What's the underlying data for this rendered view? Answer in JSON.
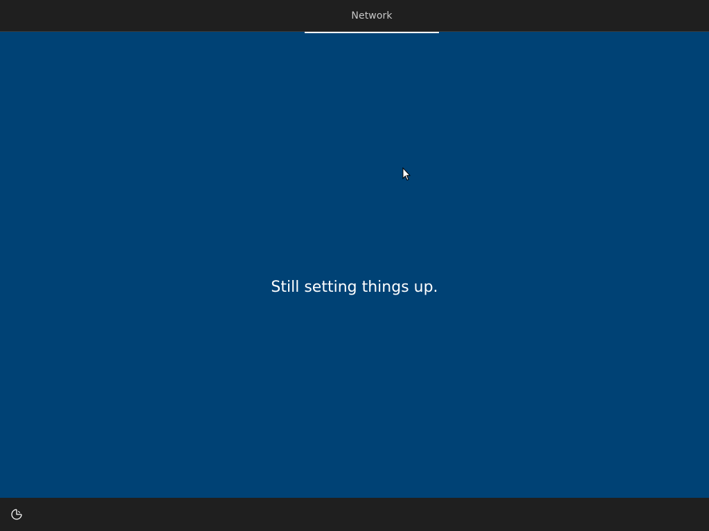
{
  "header": {
    "step_label": "Network"
  },
  "main": {
    "status_message": "Still setting things up."
  },
  "footer": {
    "accessibility_icon": "ease-of-access-icon"
  },
  "theme": {
    "background": "#004275",
    "bar": "#1f1f1f",
    "text": "#ffffff"
  }
}
